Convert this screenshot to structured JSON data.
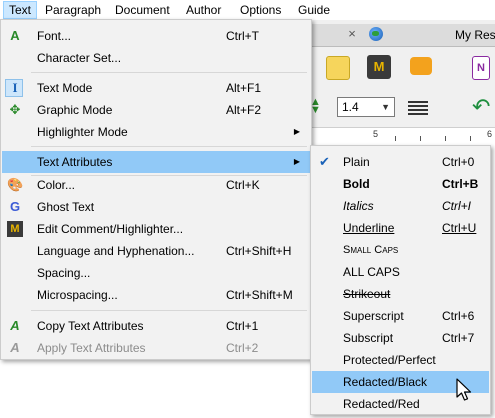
{
  "menubar": {
    "items": [
      {
        "label": "Text",
        "active": true
      },
      {
        "label": "Paragraph"
      },
      {
        "label": "Document"
      },
      {
        "label": "Author"
      },
      {
        "label": "Options"
      },
      {
        "label": "Guide"
      }
    ]
  },
  "background": {
    "tab_close_glyph": "×",
    "doc_tab_title": "My Res",
    "spacing_value": "1.4",
    "ruler_mark_5": "5",
    "ruler_mark_6": "6"
  },
  "text_menu": {
    "items": [
      {
        "icon": "font-icon",
        "label": "Font...",
        "shortcut": "Ctrl+T"
      },
      {
        "label": "Character Set..."
      },
      {
        "icon": "text-mode-icon",
        "label": "Text Mode",
        "shortcut": "Alt+F1",
        "checked": true
      },
      {
        "icon": "graphic-mode-icon",
        "label": "Graphic Mode",
        "shortcut": "Alt+F2"
      },
      {
        "label": "Highlighter Mode",
        "submenu": true
      },
      {
        "label": "Text Attributes",
        "submenu": true,
        "highlighted": true
      },
      {
        "icon": "color-palette-icon",
        "label": "Color...",
        "shortcut": "Ctrl+K"
      },
      {
        "icon": "ghost-text-icon",
        "label": "Ghost Text"
      },
      {
        "icon": "comment-highlighter-icon",
        "label": "Edit Comment/Highlighter..."
      },
      {
        "label": "Language and Hyphenation...",
        "shortcut": "Ctrl+Shift+H"
      },
      {
        "label": "Spacing..."
      },
      {
        "label": "Microspacing...",
        "shortcut": "Ctrl+Shift+M"
      },
      {
        "icon": "copy-attributes-icon",
        "label": "Copy Text Attributes",
        "shortcut": "Ctrl+1"
      },
      {
        "icon": "apply-attributes-icon",
        "label": "Apply Text Attributes",
        "shortcut": "Ctrl+2",
        "disabled": true
      }
    ]
  },
  "attributes_menu": {
    "items": [
      {
        "label": "Plain",
        "shortcut": "Ctrl+0",
        "checked": true
      },
      {
        "label": "Bold",
        "shortcut": "Ctrl+B",
        "style": "bold"
      },
      {
        "label": "Italics",
        "shortcut": "Ctrl+I",
        "style": "italic"
      },
      {
        "label": "Underline",
        "shortcut": "Ctrl+U",
        "style": "underline"
      },
      {
        "label": "Small Caps",
        "style": "smallcaps"
      },
      {
        "label": "ALL CAPS"
      },
      {
        "label": "Strikeout",
        "style": "strike"
      },
      {
        "label": "Superscript",
        "shortcut": "Ctrl+6"
      },
      {
        "label": "Subscript",
        "shortcut": "Ctrl+7"
      },
      {
        "label": "Protected/Perfect"
      },
      {
        "label": "Redacted/Black",
        "highlighted": true
      },
      {
        "label": "Redacted/Red"
      }
    ]
  },
  "colors": {
    "menu_highlight": "#91c9f7",
    "menubar_active": "#cce8ff",
    "menu_background": "#f2f2f2",
    "disabled_text": "#8c8c8c"
  }
}
